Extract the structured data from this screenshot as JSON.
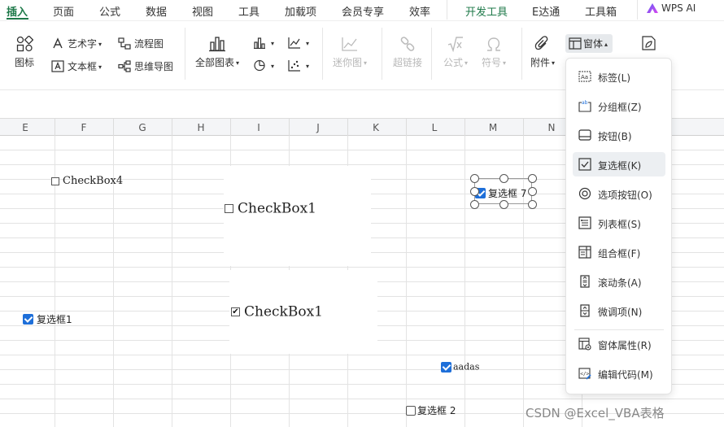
{
  "menubar": {
    "tabs": [
      "插入",
      "页面",
      "公式",
      "数据",
      "视图",
      "工具",
      "加载项",
      "会员专享",
      "效率",
      "开发工具",
      "E达通",
      "工具箱"
    ],
    "active_tab": "插入",
    "wps_ai": "WPS AI"
  },
  "ribbon": {
    "icon_label": "图标",
    "art_text": "艺术字",
    "flowchart": "流程图",
    "textbox": "文本框",
    "mindmap": "思维导图",
    "all_charts": "全部图表",
    "sparkline": "迷你图",
    "hyperlink": "超链接",
    "formula": "公式",
    "symbol": "符号",
    "attachment": "附件",
    "form": "窗体"
  },
  "columns": [
    "E",
    "F",
    "G",
    "H",
    "I",
    "J",
    "K",
    "L",
    "M",
    "N"
  ],
  "sheet": {
    "checkbox4": "CheckBox4",
    "checkbox1_unchecked": "CheckBox1",
    "checkbox1_checked": "CheckBox1",
    "fuxuankuang1": "复选框1",
    "fuxuankuang7": "复选框 7",
    "aadas": "aadas",
    "fuxuankuang2": "复选框 2"
  },
  "dropdown": {
    "items": [
      {
        "label": "标签(L)",
        "icon": "label-icon"
      },
      {
        "label": "分组框(Z)",
        "icon": "groupbox-icon"
      },
      {
        "label": "按钮(B)",
        "icon": "button-icon"
      },
      {
        "label": "复选框(K)",
        "icon": "checkbox-icon"
      },
      {
        "label": "选项按钮(O)",
        "icon": "radio-icon"
      },
      {
        "label": "列表框(S)",
        "icon": "listbox-icon"
      },
      {
        "label": "组合框(F)",
        "icon": "combobox-icon"
      },
      {
        "label": "滚动条(A)",
        "icon": "scrollbar-icon"
      },
      {
        "label": "微调项(N)",
        "icon": "spinner-icon"
      },
      {
        "label": "窗体属性(R)",
        "icon": "form-properties-icon"
      },
      {
        "label": "编辑代码(M)",
        "icon": "edit-code-icon"
      }
    ],
    "highlighted": "复选框(K)"
  },
  "watermark": "CSDN @Excel_VBA表格"
}
